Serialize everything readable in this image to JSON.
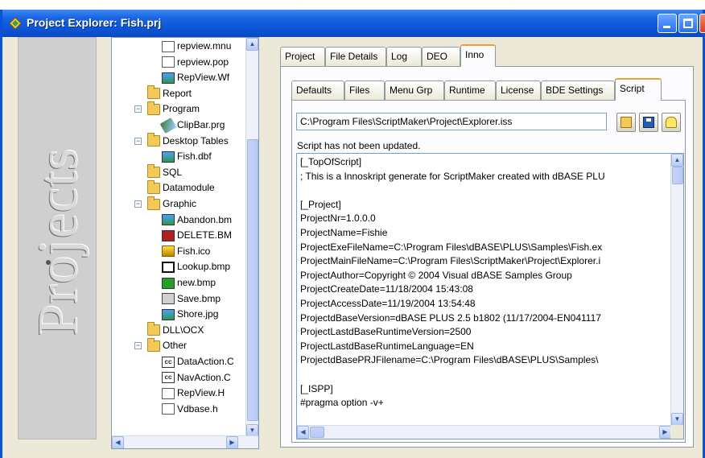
{
  "window": {
    "title": "Project Explorer: Fish.prj",
    "app_icon": "diamond-app-icon",
    "accent": "#0a52d8"
  },
  "banner": {
    "text": "Projects"
  },
  "tree": {
    "items": [
      {
        "label": "repview.mnu",
        "icon": "file-icon"
      },
      {
        "label": "repview.pop",
        "icon": "file-icon"
      },
      {
        "label": "RepView.Wf",
        "icon": "image-icon"
      },
      {
        "label": "Report",
        "icon": "folder-icon"
      },
      {
        "label": "Program",
        "icon": "folder-icon"
      },
      {
        "label": "ClipBar.prg",
        "icon": "program-icon"
      },
      {
        "label": "Desktop Tables",
        "icon": "folder-icon"
      },
      {
        "label": "Fish.dbf",
        "icon": "table-icon"
      },
      {
        "label": "SQL",
        "icon": "folder-icon"
      },
      {
        "label": "Datamodule",
        "icon": "folder-icon"
      },
      {
        "label": "Graphic",
        "icon": "folder-icon"
      },
      {
        "label": "Abandon.bm",
        "icon": "image-icon"
      },
      {
        "label": "DELETE.BM",
        "icon": "image-icon"
      },
      {
        "label": "Fish.ico",
        "icon": "image-icon"
      },
      {
        "label": "Lookup.bmp",
        "icon": "image-icon"
      },
      {
        "label": "new.bmp",
        "icon": "image-icon"
      },
      {
        "label": "Save.bmp",
        "icon": "image-icon"
      },
      {
        "label": "Shore.jpg",
        "icon": "image-icon"
      },
      {
        "label": "DLL\\OCX",
        "icon": "folder-icon"
      },
      {
        "label": "Other",
        "icon": "folder-icon"
      },
      {
        "label": "DataAction.C",
        "icon": "cc-file-icon"
      },
      {
        "label": "NavAction.C",
        "icon": "cc-file-icon"
      },
      {
        "label": "RepView.H",
        "icon": "file-icon"
      },
      {
        "label": "Vdbase.h",
        "icon": "file-icon"
      }
    ]
  },
  "main_tabs": [
    "Project",
    "File Details",
    "Log",
    "DEO",
    "Inno"
  ],
  "main_tab_active": "Inno",
  "sub_tabs": [
    "Defaults",
    "Files",
    "Menu Grp",
    "Runtime",
    "License",
    "BDE Settings",
    "Script"
  ],
  "sub_tab_active": "Script",
  "script_path": "C:\\Program Files\\ScriptMaker\\Project\\Explorer.iss",
  "status": "Script has not been updated.",
  "script_lines": [
    "[_TopOfScript]",
    "; This is a Innoskript generate for ScriptMaker created with dBASE PLU",
    "",
    "[_Project]",
    "ProjectNr=1.0.0.0",
    "ProjectName=Fishie",
    "ProjectExeFileName=C:\\Program Files\\dBASE\\PLUS\\Samples\\Fish.ex",
    "ProjectMainFileName=C:\\Program Files\\ScriptMaker\\Project\\Explorer.i",
    "ProjectAuthor=Copyright © 2004 Visual dBASE Samples Group",
    "ProjectCreateDate=11/18/2004 15:43:08",
    "ProjectAccessDate=11/19/2004 13:54:48",
    "ProjectdBaseVersion=dBASE PLUS 2.5  b1802 (11/17/2004-EN041117",
    "ProjectLastdBaseRuntimeVersion=2500",
    "ProjectLastdBaseRuntimeLanguage=EN",
    "ProjectdBasePRJFilename=C:\\Program Files\\dBASE\\PLUS\\Samples\\",
    "",
    "[_ISPP]",
    "#pragma option -v+"
  ]
}
